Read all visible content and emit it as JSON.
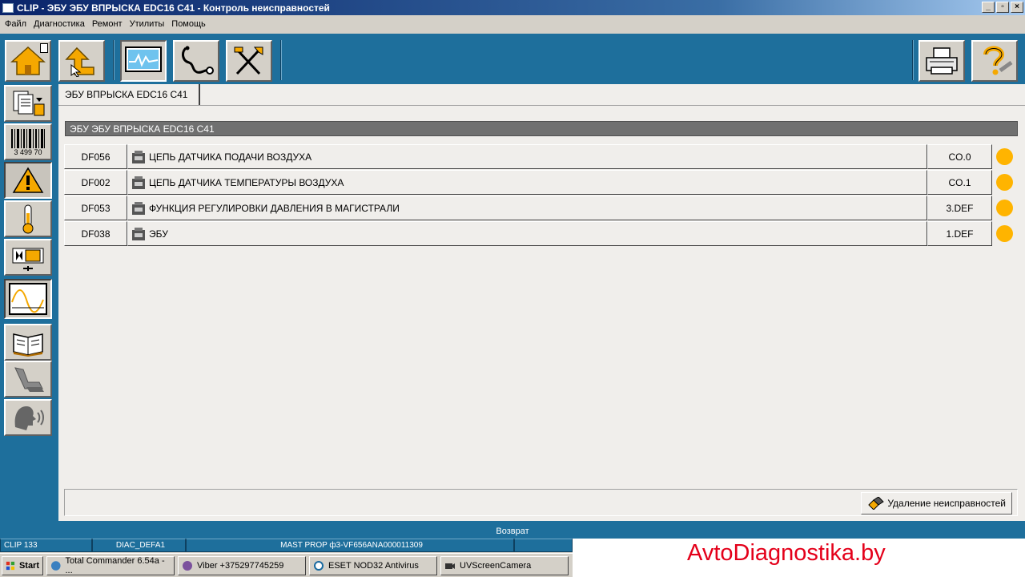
{
  "window": {
    "title": "CLIP - ЭБУ ЭБУ ВПРЫСКА EDC16 C41 - Контроль неисправностей",
    "controls": {
      "minimize": "_",
      "maximize": "▫",
      "close": "×"
    }
  },
  "menu": [
    "Файл",
    "Диагностика",
    "Ремонт",
    "Утилиты",
    "Помощь"
  ],
  "toolbar": {
    "left": [
      "home-icon",
      "up-arrow-icon",
      "oscilloscope-icon",
      "stethoscope-icon",
      "tools-icon"
    ],
    "right": [
      "printer-icon",
      "help-icon"
    ]
  },
  "sidebar": [
    "documents-icon",
    "barcode-icon",
    "warning-icon",
    "thermometer-icon",
    "actuator-icon",
    "signal-chart-icon",
    "book-icon",
    "seat-icon",
    "voice-icon"
  ],
  "barcode_text": "3 499 70",
  "tab": {
    "label": "ЭБУ ВПРЫСКА EDC16 C41"
  },
  "section": {
    "title": "ЭБУ ЭБУ ВПРЫСКА EDC16 C41"
  },
  "faults": [
    {
      "code": "DF056",
      "description": "ЦЕПЬ ДАТЧИКА ПОДАЧИ ВОЗДУХА",
      "status": "CO.0",
      "indicator_color": "#ffb400"
    },
    {
      "code": "DF002",
      "description": "ЦЕПЬ ДАТЧИКА ТЕМПЕРАТУРЫ ВОЗДУХА",
      "status": "CO.1",
      "indicator_color": "#ffb400"
    },
    {
      "code": "DF053",
      "description": "ФУНКЦИЯ РЕГУЛИРОВКИ ДАВЛЕНИЯ В МАГИСТРАЛИ",
      "status": "3.DEF",
      "indicator_color": "#ffb400"
    },
    {
      "code": "DF038",
      "description": "ЭБУ",
      "status": "1.DEF",
      "indicator_color": "#ffb400"
    }
  ],
  "actions": {
    "delete_faults": "Удаление неисправностей"
  },
  "return_label": "Возврат",
  "statusbar": [
    "CLIP 133",
    "DIAC_DEFA1",
    "MAST PROP ф3-VF656ANA000011309"
  ],
  "taskbar": {
    "start": "Start",
    "items": [
      "Total Commander 6.54a - ...",
      "Viber +375297745259",
      "ESET NOD32 Antivirus",
      "UVScreenCamera"
    ]
  },
  "watermark": "AvtoDiagnostika.by"
}
